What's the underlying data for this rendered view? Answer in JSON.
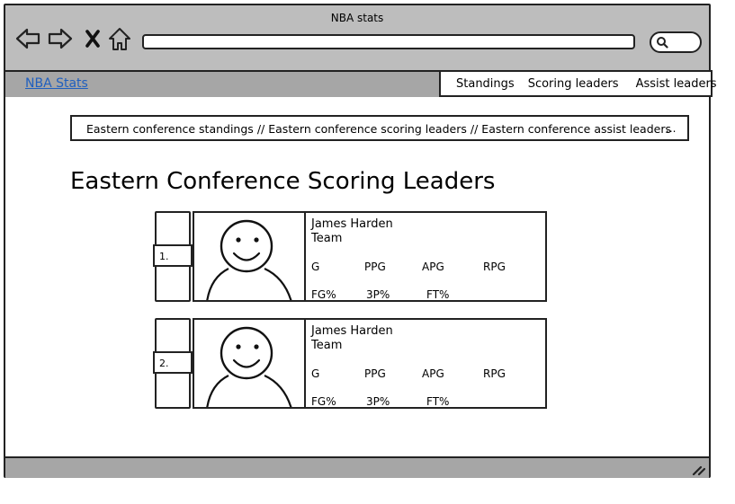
{
  "window": {
    "title": "NBA stats"
  },
  "site": {
    "name": "NBA Stats"
  },
  "menu": {
    "items": [
      "Standings",
      "Scoring leaders",
      "Assist leaders"
    ]
  },
  "breadcrumb": {
    "items": [
      "Eastern conference standings",
      "Eastern conference scoring leaders",
      "Eastern conference assist leaders"
    ],
    "separator": "//",
    "more": "..."
  },
  "page": {
    "title": "Eastern Conference Scoring Leaders"
  },
  "players": [
    {
      "rank": "1.",
      "name": "James Harden",
      "team": "Team",
      "stats_row1": [
        "G",
        "PPG",
        "APG",
        "RPG"
      ],
      "stats_row2": [
        "FG%",
        "3P%",
        "FT%"
      ]
    },
    {
      "rank": "2.",
      "name": "James Harden",
      "team": "Team",
      "stats_row1": [
        "G",
        "PPG",
        "APG",
        "RPG"
      ],
      "stats_row2": [
        "FG%",
        "3P%",
        "FT%"
      ]
    }
  ],
  "icons": [
    "back-arrow-icon",
    "forward-arrow-icon",
    "close-icon",
    "home-icon",
    "search-icon",
    "resize-grip-icon"
  ]
}
